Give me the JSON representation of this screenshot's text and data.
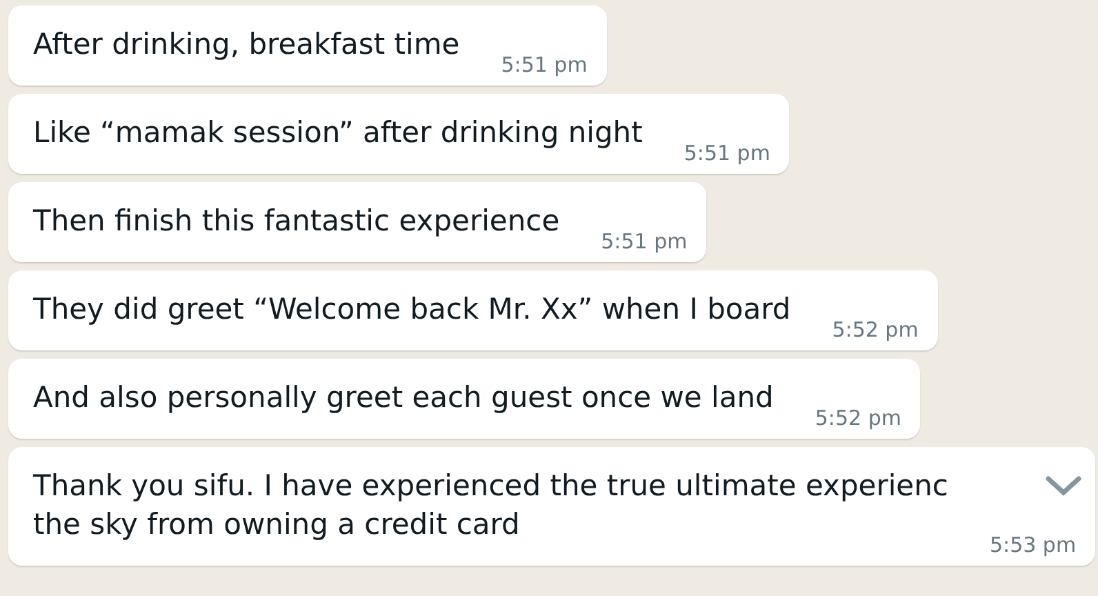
{
  "messages": [
    {
      "lines": [
        "After drinking, breakfast time"
      ],
      "time": "5:51 pm",
      "hovered": false
    },
    {
      "lines": [
        "Like “mamak session” after drinking night"
      ],
      "time": "5:51 pm",
      "hovered": false
    },
    {
      "lines": [
        "Then finish this fantastic experience"
      ],
      "time": "5:51 pm",
      "hovered": false
    },
    {
      "lines": [
        "They did greet “Welcome back Mr. Xx” when I board"
      ],
      "time": "5:52 pm",
      "hovered": false
    },
    {
      "lines": [
        "And also personally greet each guest once we land"
      ],
      "time": "5:52 pm",
      "hovered": false
    },
    {
      "lines": [
        "Thank you sifu. I have experienced the true ultimate experienc",
        "the sky from owning a credit card"
      ],
      "time": "5:53 pm",
      "hovered": true
    }
  ]
}
